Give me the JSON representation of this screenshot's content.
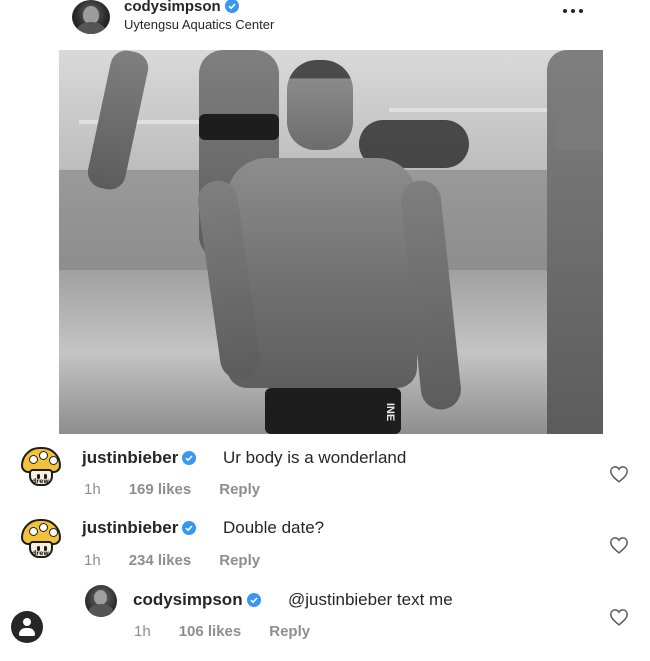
{
  "post": {
    "username": "codysimpson",
    "location": "Uytengsu Aquatics Center",
    "photo_brand_text": "INE"
  },
  "comments": [
    {
      "username": "justinbieber",
      "text": "Ur body is a wonderland",
      "time": "1h",
      "likes": "169 likes",
      "reply": "Reply",
      "avatar_text": "drew"
    },
    {
      "username": "justinbieber",
      "text": "Double date?",
      "time": "1h",
      "likes": "234 likes",
      "reply": "Reply",
      "avatar_text": "drew"
    },
    {
      "username": "codysimpson",
      "text": "@justinbieber text me",
      "time": "1h",
      "likes": "106 likes",
      "reply": "Reply"
    }
  ],
  "icons": {
    "verified": "verified-badge-icon",
    "more": "more-options-icon",
    "like": "heart-icon",
    "profile": "profile-icon"
  },
  "colors": {
    "verified_blue": "#3897f0",
    "text_primary": "#262626",
    "text_secondary": "#8e8e8e",
    "mushroom_yellow": "#f2c23a"
  }
}
